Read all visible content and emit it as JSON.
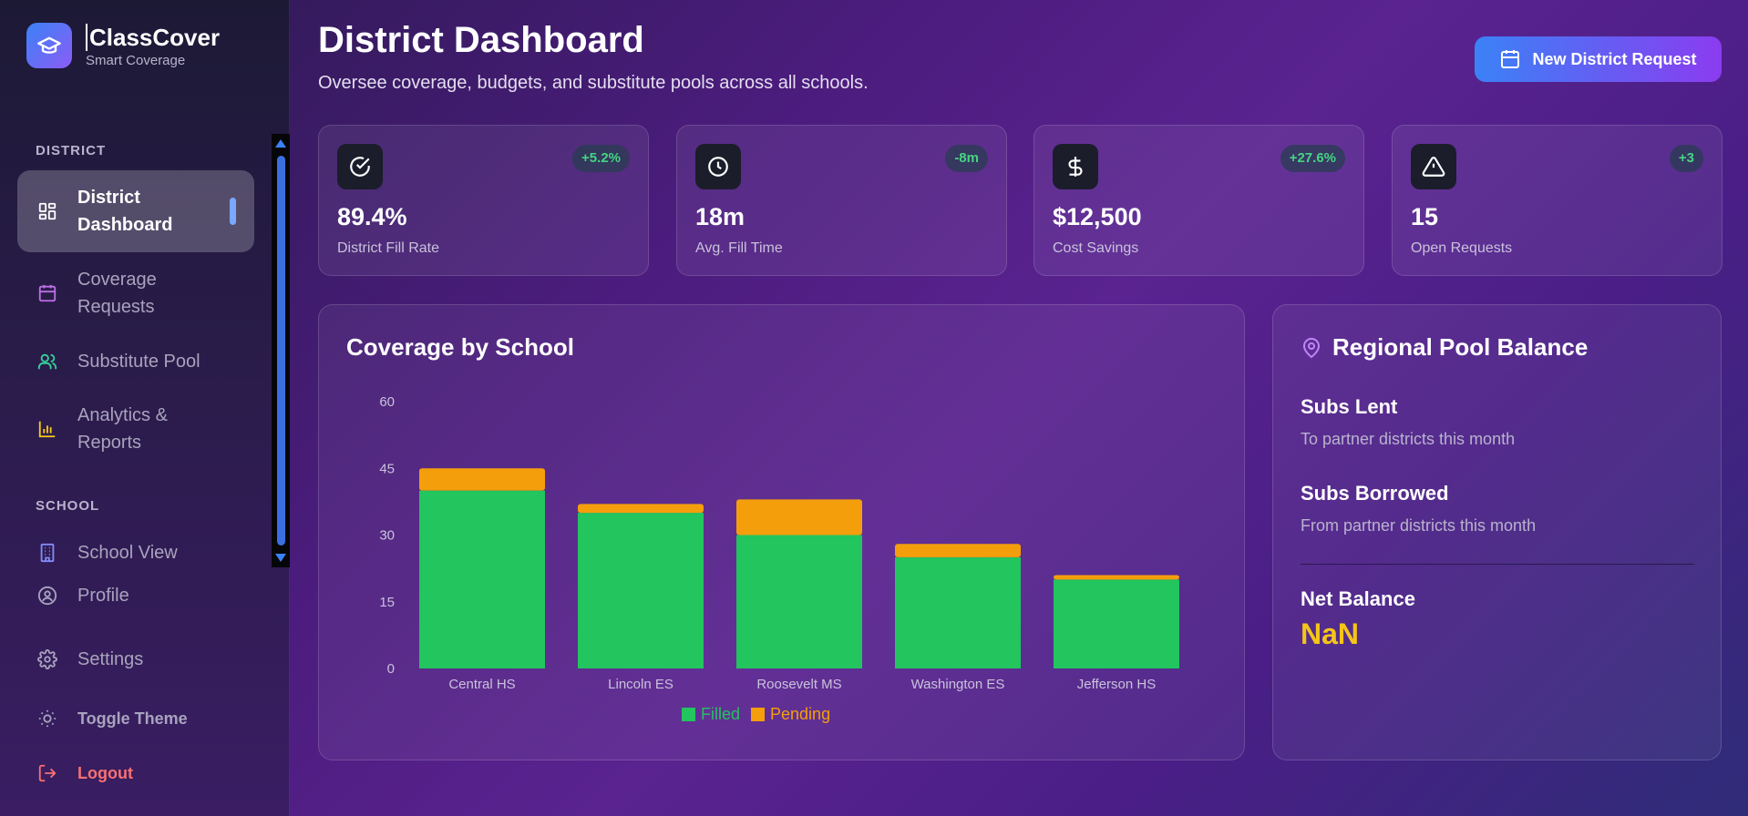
{
  "brand": {
    "name": "ClassCover",
    "subtitle": "Smart Coverage"
  },
  "sidebar": {
    "district_label": "DISTRICT",
    "school_label": "SCHOOL",
    "items": [
      {
        "label": "District Dashboard",
        "icon": "dashboard-icon"
      },
      {
        "label": "Coverage Requests",
        "icon": "calendar-icon"
      },
      {
        "label": "Substitute Pool",
        "icon": "users-icon"
      },
      {
        "label": "Analytics & Reports",
        "icon": "bar-chart-icon"
      },
      {
        "label": "School View",
        "icon": "building-icon"
      },
      {
        "label": "Profile",
        "icon": "user-circle-icon"
      },
      {
        "label": "Settings",
        "icon": "gear-icon"
      },
      {
        "label": "Toggle Theme",
        "icon": "sun-icon"
      },
      {
        "label": "Logout",
        "icon": "logout-icon"
      }
    ]
  },
  "header": {
    "title": "District Dashboard",
    "subtitle": "Oversee coverage, budgets, and substitute pools across all schools.",
    "new_request_label": "New District Request"
  },
  "stats": [
    {
      "value": "89.4%",
      "label": "District Fill Rate",
      "badge": "+5.2%",
      "icon": "check-circle-icon"
    },
    {
      "value": "18m",
      "label": "Avg. Fill Time",
      "badge": "-8m",
      "icon": "clock-icon"
    },
    {
      "value": "$12,500",
      "label": "Cost Savings",
      "badge": "+27.6%",
      "icon": "dollar-icon"
    },
    {
      "value": "15",
      "label": "Open Requests",
      "badge": "+3",
      "icon": "alert-triangle-icon"
    }
  ],
  "chart_data": {
    "type": "bar",
    "stacked": true,
    "title": "Coverage by School",
    "categories": [
      "Central HS",
      "Lincoln ES",
      "Roosevelt MS",
      "Washington ES",
      "Jefferson HS"
    ],
    "series": [
      {
        "name": "Filled",
        "color": "#22c55e",
        "values": [
          40,
          35,
          30,
          25,
          20
        ]
      },
      {
        "name": "Pending",
        "color": "#f59e0b",
        "values": [
          5,
          2,
          8,
          3,
          1
        ]
      }
    ],
    "yticks": [
      "0",
      "15",
      "30",
      "45",
      "60"
    ],
    "ylim": [
      0,
      60
    ],
    "legend": "bottom",
    "grid": false
  },
  "pool": {
    "title": "Regional Pool Balance",
    "lent_title": "Subs Lent",
    "lent_sub": "To partner districts this month",
    "borrowed_title": "Subs Borrowed",
    "borrowed_sub": "From partner districts this month",
    "net_title": "Net Balance",
    "net_value": "NaN"
  },
  "colors": {
    "accent": "#3b82f6",
    "filled": "#22c55e",
    "pending": "#f59e0b",
    "positive": "#45d483",
    "net": "#f5c518",
    "logout": "#f87171"
  }
}
